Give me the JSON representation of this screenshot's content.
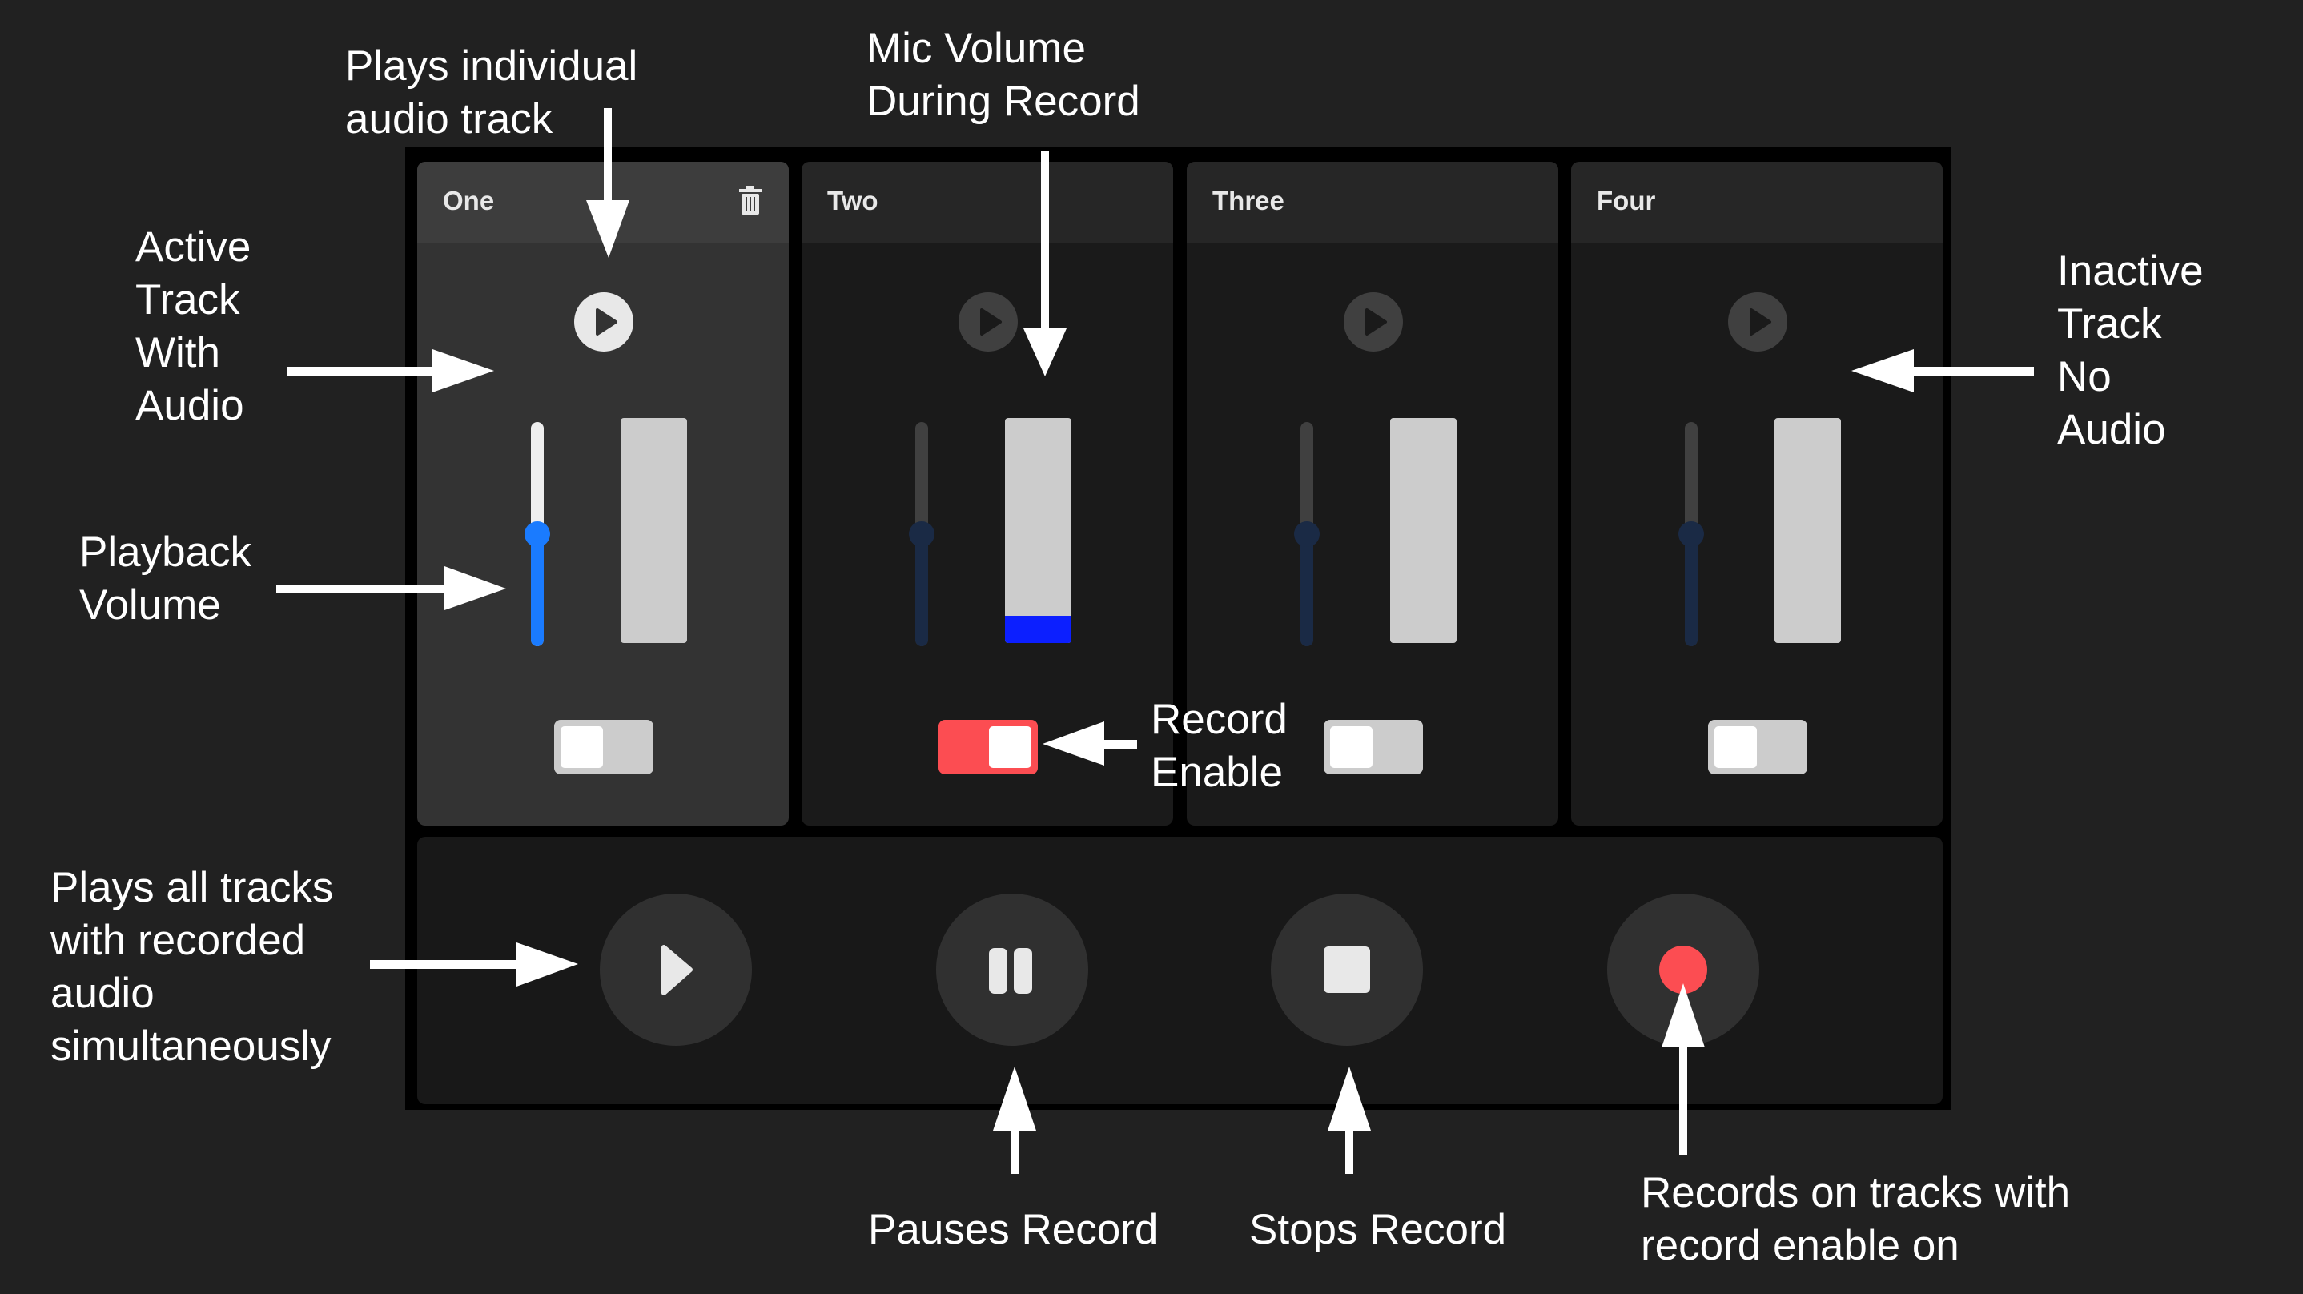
{
  "tracks": [
    {
      "name": "One",
      "state": "active",
      "has_delete": true,
      "playback_volume": 0.5,
      "mic_level": 0,
      "record_enabled": false
    },
    {
      "name": "Two",
      "state": "inactive",
      "has_delete": false,
      "playback_volume": 0.5,
      "mic_level": 0.12,
      "record_enabled": true
    },
    {
      "name": "Three",
      "state": "inactive",
      "has_delete": false,
      "playback_volume": 0.5,
      "mic_level": 0,
      "record_enabled": false
    },
    {
      "name": "Four",
      "state": "inactive",
      "has_delete": false,
      "playback_volume": 0.5,
      "mic_level": 0,
      "record_enabled": false
    }
  ],
  "transport": {
    "play_icon": "play-icon",
    "pause_icon": "pause-icon",
    "stop_icon": "stop-icon",
    "record_icon": "record-icon"
  },
  "colors": {
    "accent_blue": "#1a7bff",
    "meter_blue": "#0c1fff",
    "record_red": "#fc4d52"
  },
  "annotations": {
    "plays_individual": "Plays individual\naudio track",
    "mic_volume": "Mic Volume\nDuring Record",
    "active_track": "Active\nTrack\nWith\nAudio",
    "inactive_track": "Inactive\nTrack\nNo\nAudio",
    "playback_volume": "Playback\nVolume",
    "record_enable": "Record\nEnable",
    "plays_all": "Plays all tracks\nwith recorded\naudio\nsimultaneously",
    "pauses_record": "Pauses Record",
    "stops_record": "Stops Record",
    "records_on": "Records on tracks with\nrecord enable on"
  }
}
